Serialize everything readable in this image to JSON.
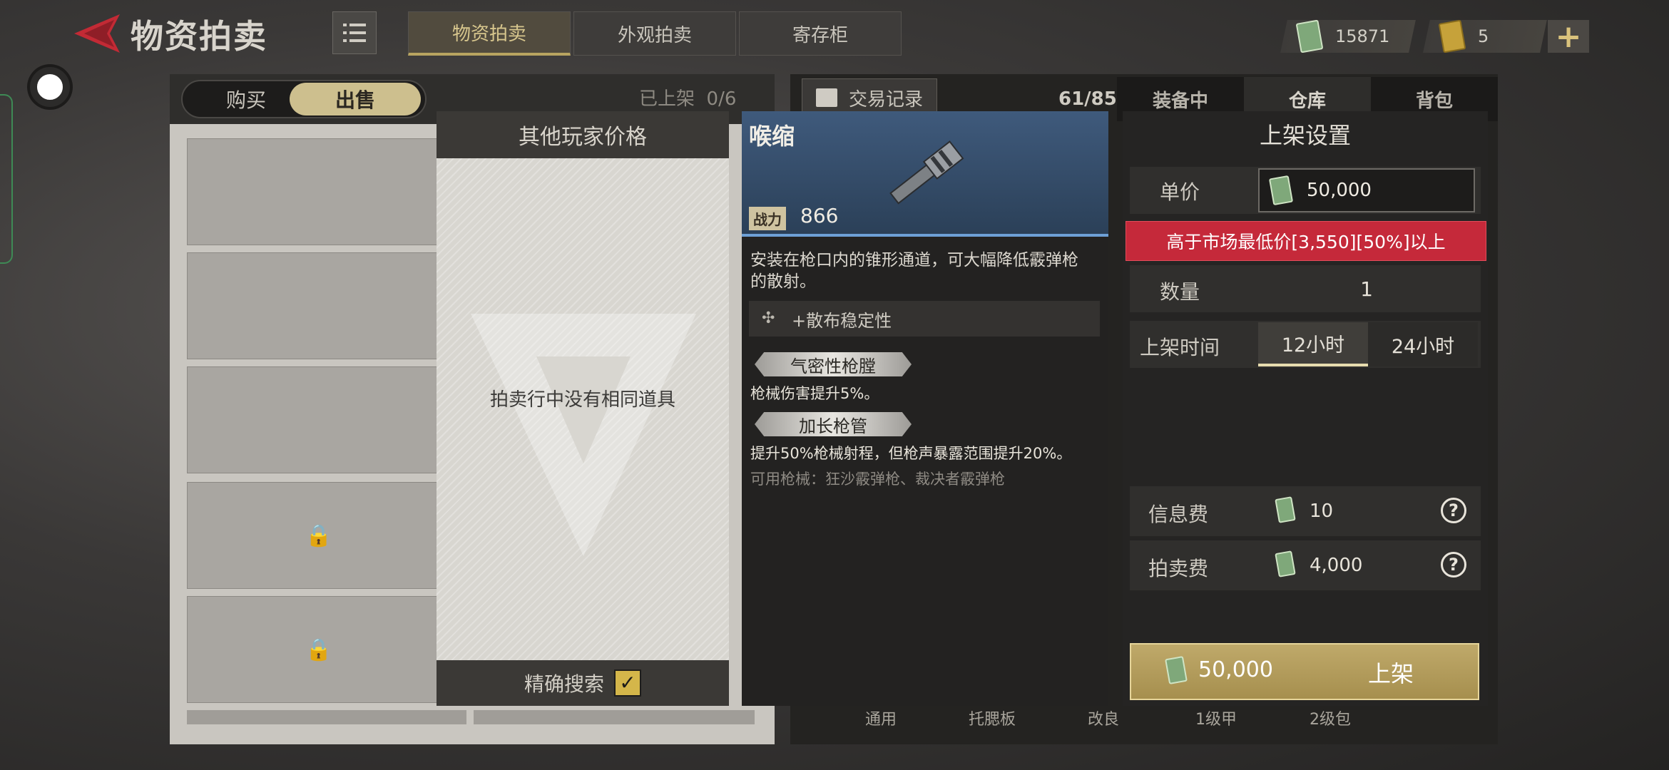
{
  "header": {
    "title": "物资拍卖",
    "tabs": [
      {
        "label": "物资拍卖",
        "active": true
      },
      {
        "label": "外观拍卖",
        "active": false
      },
      {
        "label": "寄存柜",
        "active": false
      }
    ],
    "cash": "15871",
    "tickets": "5",
    "plus": "+"
  },
  "trade_mode": {
    "buy": "购买",
    "sell": "出售",
    "active": "sell"
  },
  "listed": {
    "label": "已上架",
    "value": "0/6"
  },
  "other_prices": {
    "title": "其他玩家价格",
    "empty_text": "拍卖行中没有相同道具",
    "exact_search": "精确搜索",
    "exact_checked": true
  },
  "inventory": {
    "trade_records": "交易记录",
    "count": "61/85",
    "tabs": [
      {
        "label": "装备中"
      },
      {
        "label": "仓库",
        "active": true
      },
      {
        "label": "背包"
      }
    ],
    "categories": [
      "通用",
      "托腮板",
      "改良",
      "1级甲",
      "2级包"
    ]
  },
  "item": {
    "name": "喉缩",
    "power_label": "战力",
    "power_value": "866",
    "description": "安装在枪口内的锥形通道，可大幅降低霰弹枪的散射。",
    "stat": "+散布稳定性",
    "perks": [
      {
        "name": "气密性枪膛",
        "desc": "枪械伤害提升5%。"
      },
      {
        "name": "加长枪管",
        "desc": "提升50%枪械射程，但枪声暴露范围提升20%。"
      }
    ],
    "usable": "可用枪械：狂沙霰弹枪、裁决者霰弹枪"
  },
  "listing": {
    "title": "上架设置",
    "unit_price_label": "单价",
    "unit_price": "50,000",
    "warning": "高于市场最低价[3,550][50%]以上",
    "quantity_label": "数量",
    "quantity": "1",
    "duration_label": "上架时间",
    "duration_options": [
      {
        "label": "12小时",
        "active": true
      },
      {
        "label": "24小时",
        "active": false
      }
    ],
    "info_fee_label": "信息费",
    "info_fee": "10",
    "auction_fee_label": "拍卖费",
    "auction_fee": "4,000",
    "help": "?",
    "total": "50,000",
    "submit": "上架"
  },
  "colors": {
    "accent_gold": "#b8a460",
    "warning_red": "#c5293a",
    "item_blue": "#3f5a7c"
  }
}
